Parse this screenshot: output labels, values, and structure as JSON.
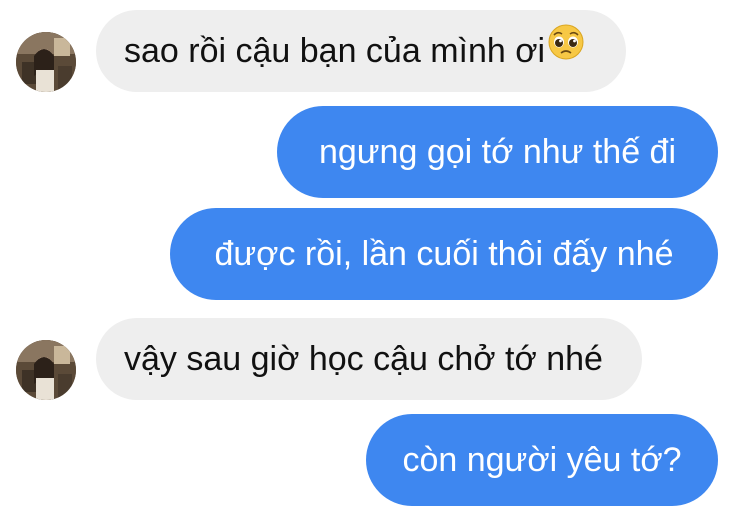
{
  "messages": [
    {
      "direction": "incoming",
      "text": "sao rồi cậu bạn của mình ơi",
      "emoji": "pleading-face"
    },
    {
      "direction": "outgoing",
      "text": "ngưng gọi tớ như thế đi"
    },
    {
      "direction": "outgoing",
      "text": "được rồi, lần cuối thôi đấy nhé"
    },
    {
      "direction": "incoming",
      "text": "vậy sau giờ học cậu chở tớ nhé"
    },
    {
      "direction": "outgoing",
      "text": "còn người yêu tớ?"
    }
  ],
  "colors": {
    "incoming_bubble": "#eeeeee",
    "outgoing_bubble": "#3e87f0",
    "incoming_text": "#111111",
    "outgoing_text": "#ffffff"
  }
}
